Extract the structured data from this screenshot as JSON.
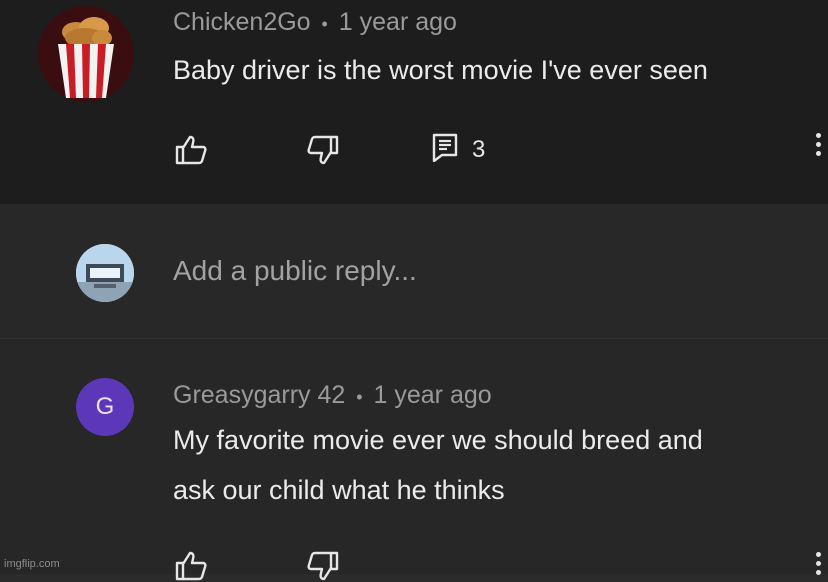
{
  "comment": {
    "author": "Chicken2Go",
    "time": "1 year ago",
    "text": "Baby driver is the worst movie I've ever seen",
    "reply_count": "3"
  },
  "reply_box": {
    "placeholder": "Add a public reply..."
  },
  "reply": {
    "avatar_letter": "G",
    "author": "Greasygarry 42",
    "time": "1 year ago",
    "text_line1": "My favorite movie ever we should breed and",
    "text_line2": "ask our child what he thinks"
  },
  "separator": "•",
  "watermark": "imgflip.com",
  "colors": {
    "top_background": "#1d1d1d",
    "background": "#282828",
    "avatar_g": "#5c38b8",
    "text": "#ebebeb",
    "meta": "#9a9a9a"
  }
}
